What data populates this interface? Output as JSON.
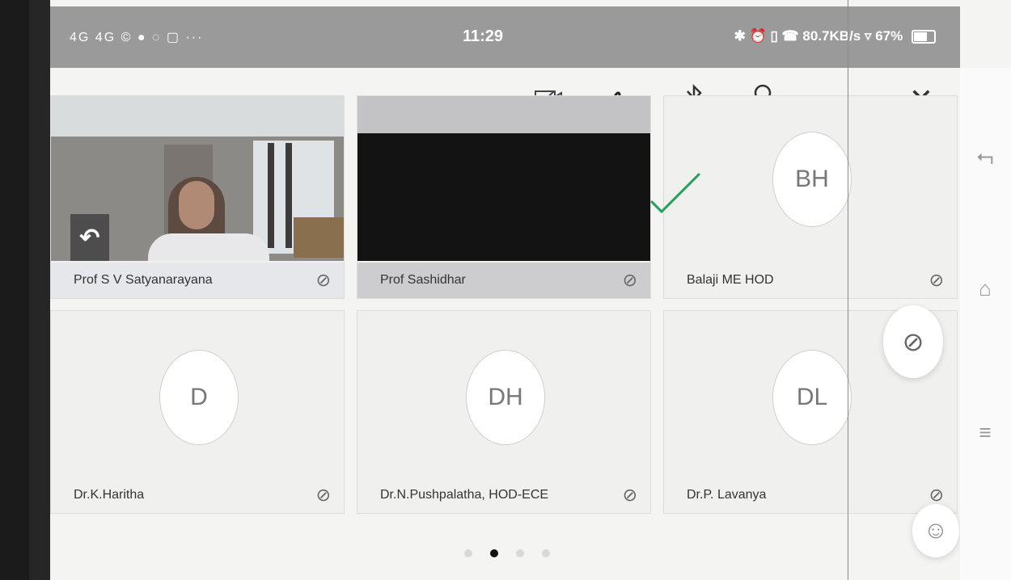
{
  "status_bar": {
    "left_icons": "4G 4G © ● ◌ ▢ ···",
    "time": "11:29",
    "right_text": "✱ ⏰ ▯ ☎ 80.7KB/s ▿ 67%"
  },
  "toolbar": {
    "video_icon": "camera-off-icon",
    "draw_icon": "scribble-icon",
    "bluetooth_icon": "bluetooth-icon",
    "participants_icon": "participants-icon",
    "more_label": "···",
    "close_label": "✕"
  },
  "participants": [
    {
      "name": "Prof S V Satyanarayana",
      "initials": "",
      "has_video": true
    },
    {
      "name": "Prof Sashidhar",
      "initials": "",
      "has_video": true
    },
    {
      "name": "Balaji ME HOD",
      "initials": "BH",
      "has_video": false
    },
    {
      "name": "Dr.K.Haritha",
      "initials": "D",
      "has_video": false
    },
    {
      "name": "Dr.N.Pushpalatha, HOD-ECE",
      "initials": "DH",
      "has_video": false
    },
    {
      "name": "Dr.P. Lavanya",
      "initials": "DL",
      "has_video": false
    }
  ],
  "pagination": {
    "pages": 4,
    "active": 2
  },
  "nav": {
    "back": "⮢",
    "home": "⌂",
    "menu": "≡"
  },
  "colors": {
    "status_bar": "#9a9a9a",
    "check": "#23a05a"
  }
}
